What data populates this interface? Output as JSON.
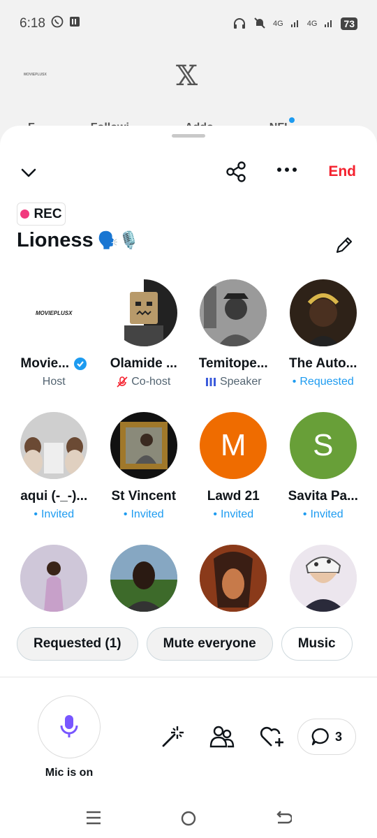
{
  "status_bar": {
    "time": "6:18",
    "network1": "4G",
    "network2": "4G",
    "battery": "73"
  },
  "background": {
    "logo_small": "MOVIEPLUSX",
    "tabs": [
      "F",
      "Followi",
      "Addo",
      "NFI"
    ]
  },
  "header": {
    "end_label": "End"
  },
  "space": {
    "rec_label": "REC",
    "title": "Lioness",
    "title_emojis": "🗣️🎙️"
  },
  "participants": [
    {
      "name": "Movie...",
      "role": "Host",
      "role_type": "host",
      "verified": true,
      "avatar_text": "MOVIEPLUSX",
      "avatar_color": "#ffffff"
    },
    {
      "name": "Olamide ...",
      "role": "Co-host",
      "role_type": "cohost",
      "avatar_color": "#2a2a2a"
    },
    {
      "name": "Temitope...",
      "role": "Speaker",
      "role_type": "speaker",
      "avatar_color": "#777777"
    },
    {
      "name": "The Auto...",
      "role": "Requested",
      "role_type": "requested",
      "avatar_color": "#3a2a1a"
    },
    {
      "name": "aqui (-_-)...",
      "role": "Invited",
      "role_type": "invited",
      "avatar_color": "#d9d9d9"
    },
    {
      "name": "St Vincent",
      "role": "Invited",
      "role_type": "invited",
      "avatar_color": "#8a6a2a"
    },
    {
      "name": "Lawd 21",
      "role": "Invited",
      "role_type": "invited",
      "avatar_letter": "M",
      "avatar_color": "#ef6c00"
    },
    {
      "name": "Savita Pa...",
      "role": "Invited",
      "role_type": "invited",
      "avatar_letter": "S",
      "avatar_color": "#689f38"
    },
    {
      "name": "",
      "role": "",
      "role_type": "",
      "avatar_color": "#d6cfe0"
    },
    {
      "name": "",
      "role": "",
      "role_type": "",
      "avatar_color": "#5a7a9a"
    },
    {
      "name": "",
      "role": "",
      "role_type": "",
      "avatar_color": "#b5532a"
    },
    {
      "name": "",
      "role": "",
      "role_type": "",
      "avatar_color": "#e8e2ea"
    }
  ],
  "chips": {
    "requested": "Requested (1)",
    "mute": "Mute everyone",
    "music": "Music"
  },
  "controls": {
    "mic_label": "Mic is on",
    "comment_count": "3"
  },
  "colors": {
    "accent": "#1d9bf0",
    "end_red": "#f4212e",
    "rec_pink": "#f1397e",
    "mic_purple": "#7856ff"
  }
}
